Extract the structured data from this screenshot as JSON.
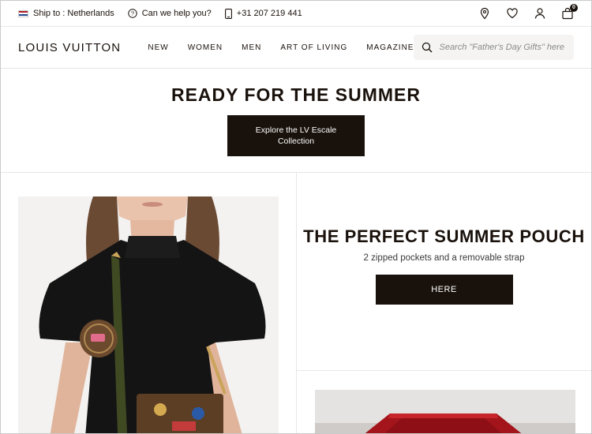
{
  "topbar": {
    "ship_to": "Ship to : Netherlands",
    "help": "Can we help you?",
    "phone": "+31 207 219 441",
    "cart_count": "0"
  },
  "header": {
    "logo": "LOUIS VUITTON",
    "nav": [
      "NEW",
      "WOMEN",
      "MEN",
      "ART OF LIVING",
      "MAGAZINE"
    ],
    "search_placeholder": "Search \"Father's Day Gifts\" here"
  },
  "hero": {
    "title": "READY FOR THE SUMMER",
    "button": "Explore the LV Escale Collection"
  },
  "promo": {
    "title": "THE PERFECT SUMMER POUCH",
    "subtitle": "2 zipped pockets and a removable strap",
    "button": "HERE"
  },
  "colors": {
    "brand_dark": "#19110b",
    "flag_red": "#ae1c28",
    "flag_white": "#ffffff",
    "flag_blue": "#21468b"
  },
  "icons": [
    "flag-nl-icon",
    "help-icon",
    "phone-icon",
    "location-pin-icon",
    "heart-icon",
    "user-icon",
    "bag-icon",
    "search-icon"
  ]
}
